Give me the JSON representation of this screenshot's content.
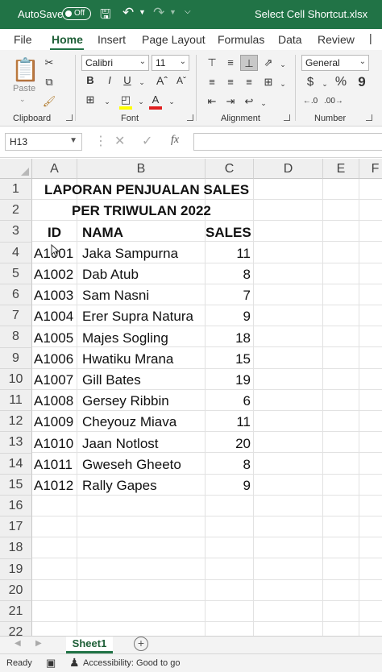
{
  "titlebar": {
    "autosave_label": "AutoSave",
    "autosave_state": "Off",
    "filename": "Select Cell Shortcut.xlsx",
    "icons": [
      "save-icon",
      "undo-icon",
      "redo-icon",
      "customize-qat-icon"
    ]
  },
  "ribbon_tabs": [
    "File",
    "Home",
    "Insert",
    "Page Layout",
    "Formulas",
    "Data",
    "Review"
  ],
  "active_tab": "Home",
  "ribbon": {
    "clipboard": {
      "label": "Clipboard",
      "paste_label": "Paste"
    },
    "font": {
      "label": "Font",
      "font_name": "Calibri",
      "font_size": "11",
      "bold": "B",
      "italic": "I",
      "underline": "U"
    },
    "alignment": {
      "label": "Alignment"
    },
    "number": {
      "label": "Number",
      "format": "General",
      "currency": "$",
      "percent": "%",
      "comma": "9"
    }
  },
  "formula_bar": {
    "name_box": "H13",
    "fx_label": "fx",
    "value": ""
  },
  "columns": [
    "A",
    "B",
    "C",
    "D",
    "E",
    "F"
  ],
  "rows": [
    "1",
    "2",
    "3",
    "4",
    "5",
    "6",
    "7",
    "8",
    "9",
    "10",
    "11",
    "12",
    "13",
    "14",
    "15",
    "16",
    "17",
    "18",
    "19",
    "20",
    "21",
    "22"
  ],
  "sheet": {
    "title_line1": "LAPORAN PENJUALAN SALES",
    "title_line2": "PER TRIWULAN 2022",
    "headers": {
      "id": "ID",
      "nama": "NAMA",
      "sales": "SALES"
    },
    "records": [
      {
        "id": "A1001",
        "nama": "Jaka Sampurna",
        "sales": "11"
      },
      {
        "id": "A1002",
        "nama": "Dab Atub",
        "sales": "8"
      },
      {
        "id": "A1003",
        "nama": "Sam Nasni",
        "sales": "7"
      },
      {
        "id": "A1004",
        "nama": "Erer Supra Natura",
        "sales": "9"
      },
      {
        "id": "A1005",
        "nama": "Majes Sogling",
        "sales": "18"
      },
      {
        "id": "A1006",
        "nama": "Hwatiku Mrana",
        "sales": "15"
      },
      {
        "id": "A1007",
        "nama": "Gill Bates",
        "sales": "19"
      },
      {
        "id": "A1008",
        "nama": "Gersey Ribbin",
        "sales": "6"
      },
      {
        "id": "A1009",
        "nama": "Cheyouz Miava",
        "sales": "11"
      },
      {
        "id": "A1010",
        "nama": "Jaan Notlost",
        "sales": "20"
      },
      {
        "id": "A1011",
        "nama": "Gweseh Gheeto",
        "sales": "8"
      },
      {
        "id": "A1012",
        "nama": "Rally Gapes",
        "sales": "9"
      }
    ]
  },
  "sheet_tabs": [
    "Sheet1"
  ],
  "status_bar": {
    "mode": "Ready",
    "accessibility": "Accessibility: Good to go"
  },
  "colors": {
    "accent": "#217346"
  }
}
